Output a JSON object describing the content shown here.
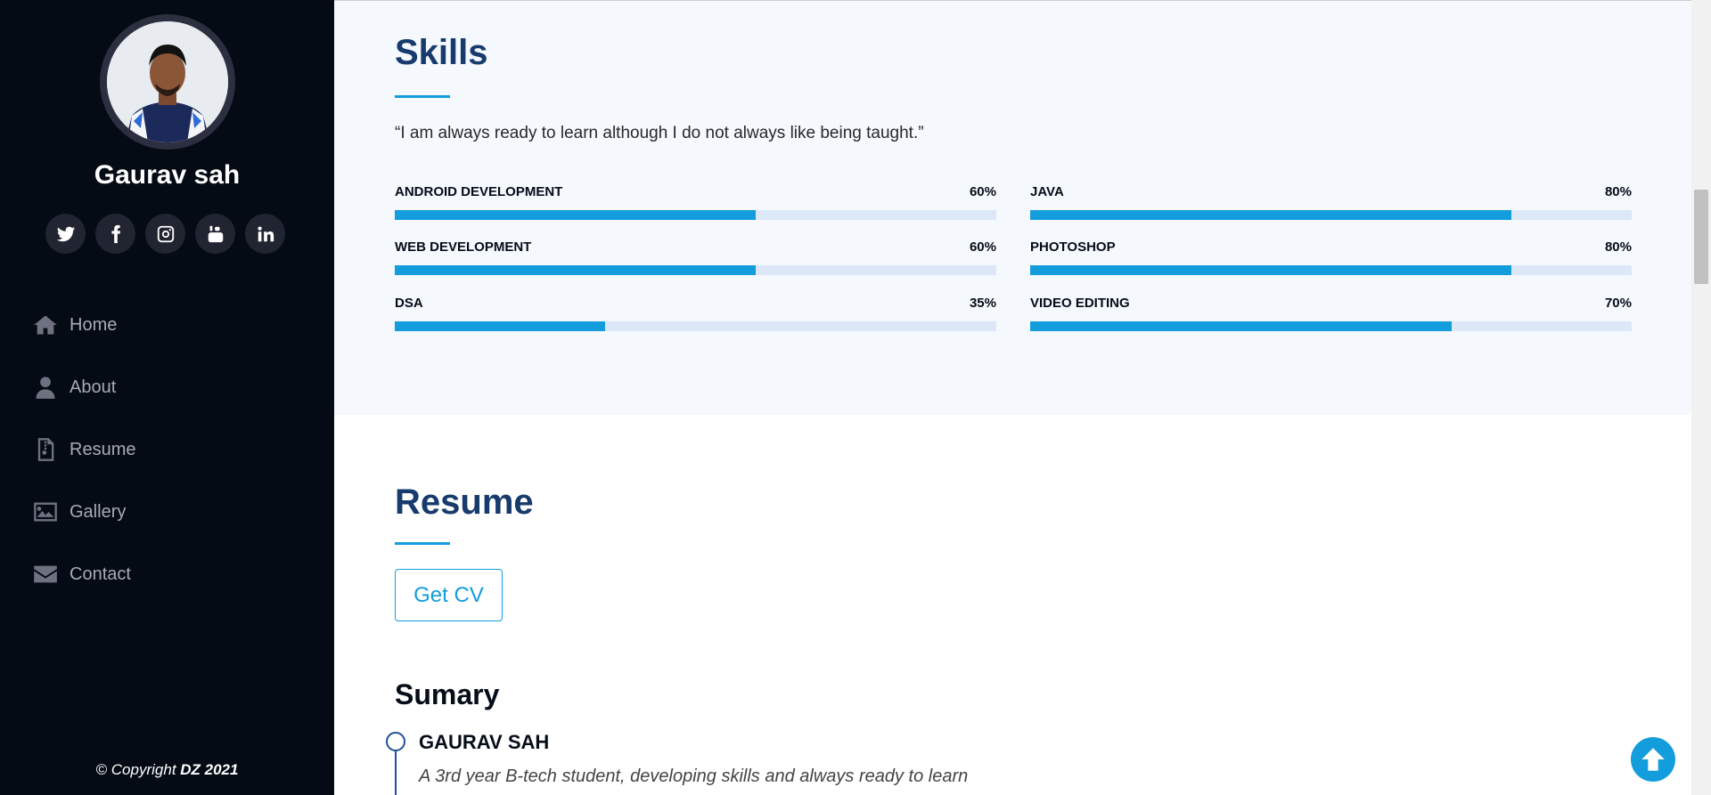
{
  "sidebar": {
    "name": "Gaurav sah",
    "socials": [
      {
        "icon": "twitter-icon"
      },
      {
        "icon": "facebook-icon"
      },
      {
        "icon": "instagram-icon"
      },
      {
        "icon": "youtube-icon"
      },
      {
        "icon": "linkedin-icon"
      }
    ],
    "nav": [
      {
        "label": "Home",
        "icon": "home-icon"
      },
      {
        "label": "About",
        "icon": "user-icon"
      },
      {
        "label": "Resume",
        "icon": "file-icon"
      },
      {
        "label": "Gallery",
        "icon": "image-icon"
      },
      {
        "label": "Contact",
        "icon": "envelope-icon"
      }
    ],
    "copyright_prefix": "© Copyright ",
    "copyright_brand": "DZ 2021"
  },
  "skills": {
    "title": "Skills",
    "quote": "“I am always ready to learn although I do not always like being taught.”",
    "items": [
      {
        "label": "ANDROID DEVELOPMENT",
        "percent_label": "60%",
        "value": 60
      },
      {
        "label": "JAVA",
        "percent_label": "80%",
        "value": 80
      },
      {
        "label": "WEB DEVELOPMENT",
        "percent_label": "60%",
        "value": 60
      },
      {
        "label": "PHOTOSHOP",
        "percent_label": "80%",
        "value": 80
      },
      {
        "label": "DSA",
        "percent_label": "35%",
        "value": 35
      },
      {
        "label": "VIDEO EDITING",
        "percent_label": "70%",
        "value": 70
      }
    ]
  },
  "resume": {
    "title": "Resume",
    "cv_button": "Get CV",
    "summary_title": "Sumary",
    "entry_name": "GAURAV SAH",
    "entry_desc": "A 3rd year B-tech student, developing skills and always ready to learn"
  },
  "colors": {
    "accent": "#149ddd",
    "heading": "#173b6c",
    "sidebar_bg": "#040b14"
  }
}
